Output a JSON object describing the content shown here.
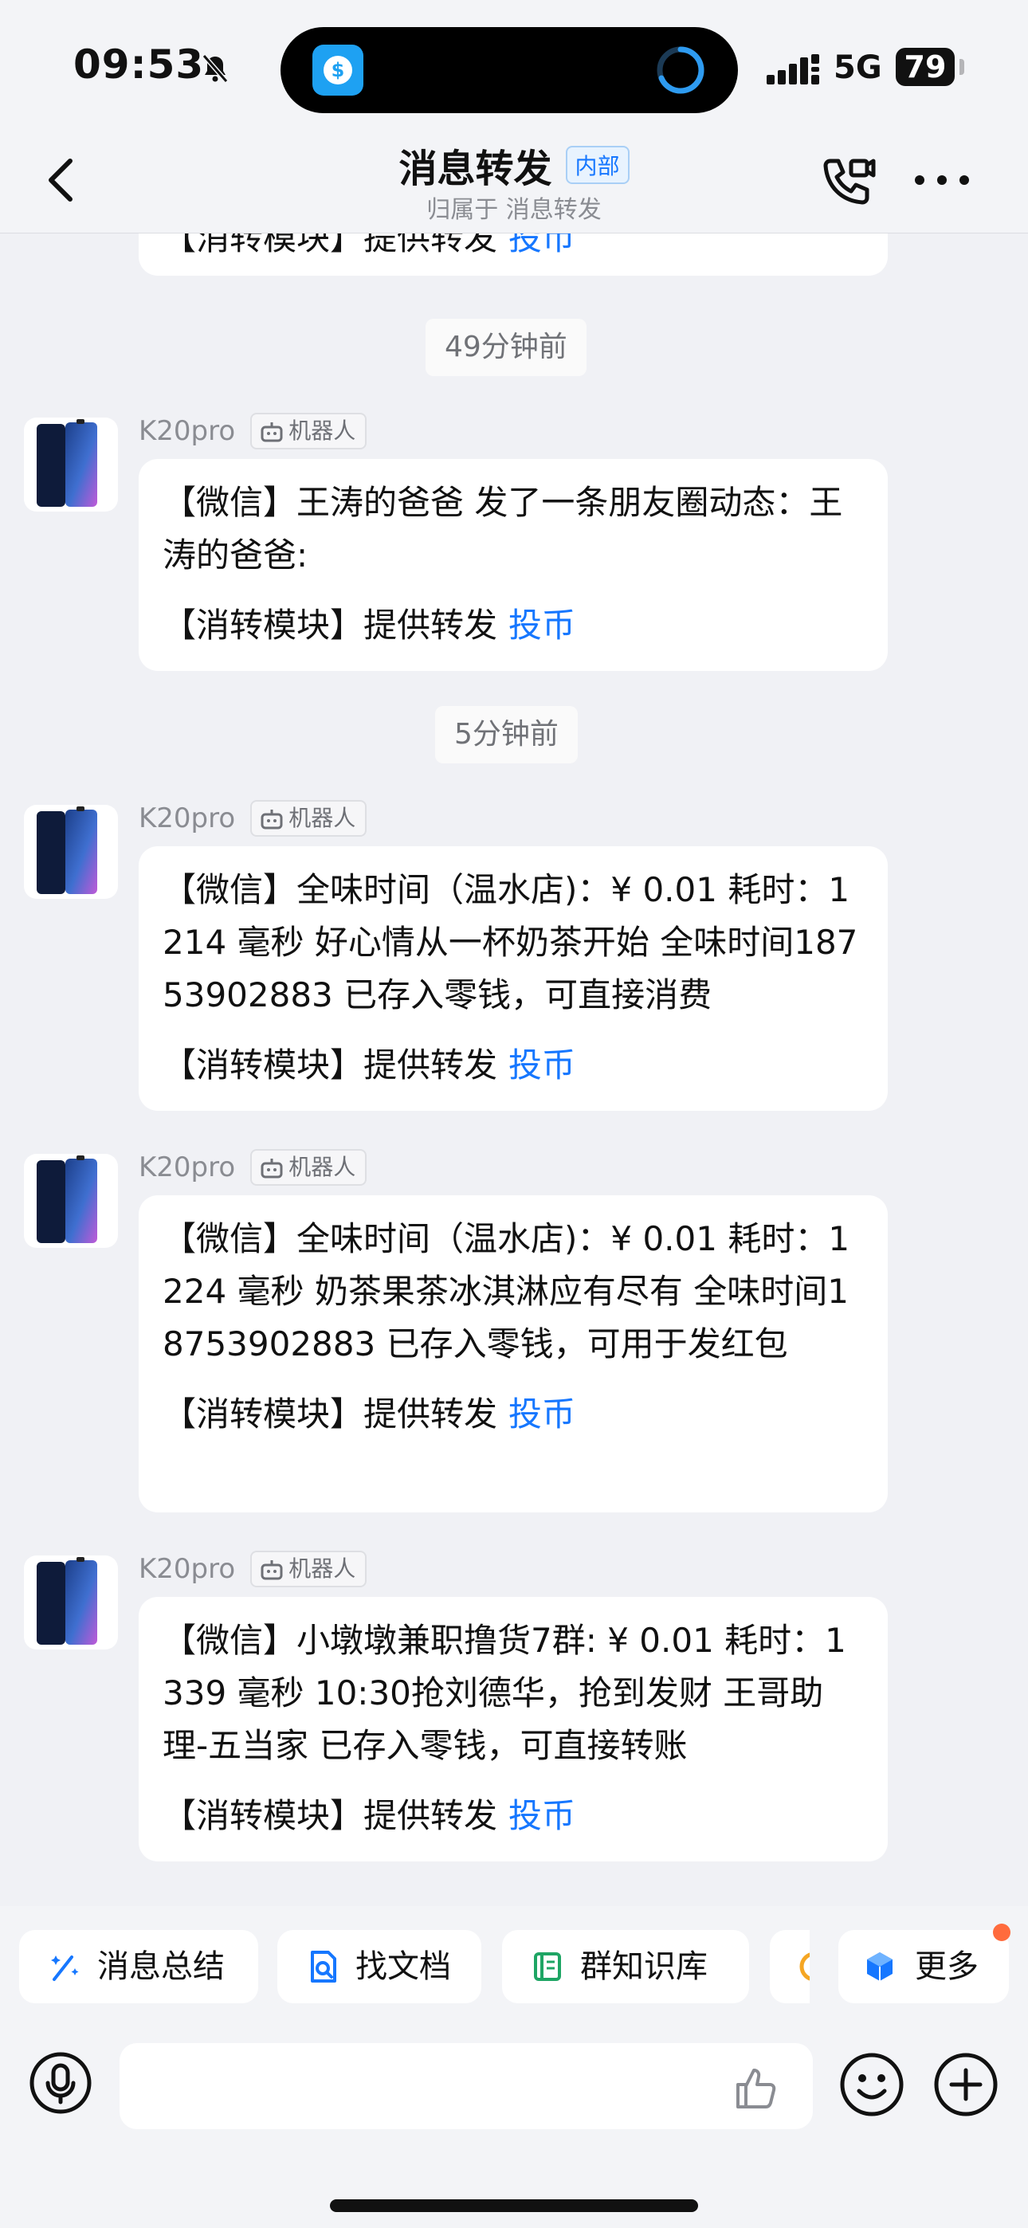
{
  "status_bar": {
    "time": "09:53",
    "network": "5G",
    "battery": "79",
    "icons": [
      "bell-muted-icon",
      "alipay-coin-icon",
      "progress-ring-icon",
      "cellular-signal-icon",
      "battery-icon"
    ]
  },
  "header": {
    "title": "消息转发",
    "tag": "内部",
    "subtitle": "归属于 消息转发",
    "icons": [
      "back-icon",
      "video-call-icon",
      "more-icon"
    ]
  },
  "chat": {
    "first_partial": {
      "forward_prefix": "【消转模块】提供转发",
      "coin_link": "投币"
    },
    "separators": [
      "49分钟前",
      "5分钟前"
    ],
    "messages": [
      {
        "sender": "K20pro",
        "badge": "机器人",
        "text": "【微信】王涛的爸爸 发了一条朋友圈动态：王涛的爸爸:",
        "forward_prefix": "【消转模块】提供转发",
        "coin_link": "投币"
      },
      {
        "sender": "K20pro",
        "badge": "机器人",
        "text": "【微信】全味时间（温水店)：¥ 0.01 耗时：1214 毫秒 好心情从一杯奶茶开始 全味时间18753902883 已存入零钱，可直接消费",
        "forward_prefix": "【消转模块】提供转发",
        "coin_link": "投币"
      },
      {
        "sender": "K20pro",
        "badge": "机器人",
        "text": "【微信】全味时间（温水店)：¥ 0.01 耗时：1224 毫秒 奶茶果茶冰淇淋应有尽有 全味时间18753902883 已存入零钱，可用于发红包",
        "forward_prefix": "【消转模块】提供转发",
        "coin_link": "投币"
      },
      {
        "sender": "K20pro",
        "badge": "机器人",
        "text": "【微信】小墩墩兼职撸货7群: ¥ 0.01 耗时：1339 毫秒 10:30抢刘德华，抢到发财 王哥助理-五当家 已存入零钱，可直接转账",
        "forward_prefix": "【消转模块】提供转发",
        "coin_link": "投币"
      }
    ]
  },
  "quick_actions": [
    {
      "label": "消息总结",
      "icon": "magic-wand-icon"
    },
    {
      "label": "找文档",
      "icon": "doc-search-icon"
    },
    {
      "label": "群知识库",
      "icon": "knowledge-book-icon"
    },
    {
      "label": "",
      "icon": "partial-app-icon"
    },
    {
      "label": "更多",
      "icon": "cube-more-icon"
    }
  ],
  "input": {
    "placeholder": "",
    "icons": [
      "voice-icon",
      "thumbs-up-icon",
      "emoji-icon",
      "plus-icon"
    ]
  },
  "colors": {
    "accent": "#1677ff",
    "background": "#f0f1f5",
    "bubble": "#ffffff",
    "notification_dot": "#ff6b3d"
  }
}
